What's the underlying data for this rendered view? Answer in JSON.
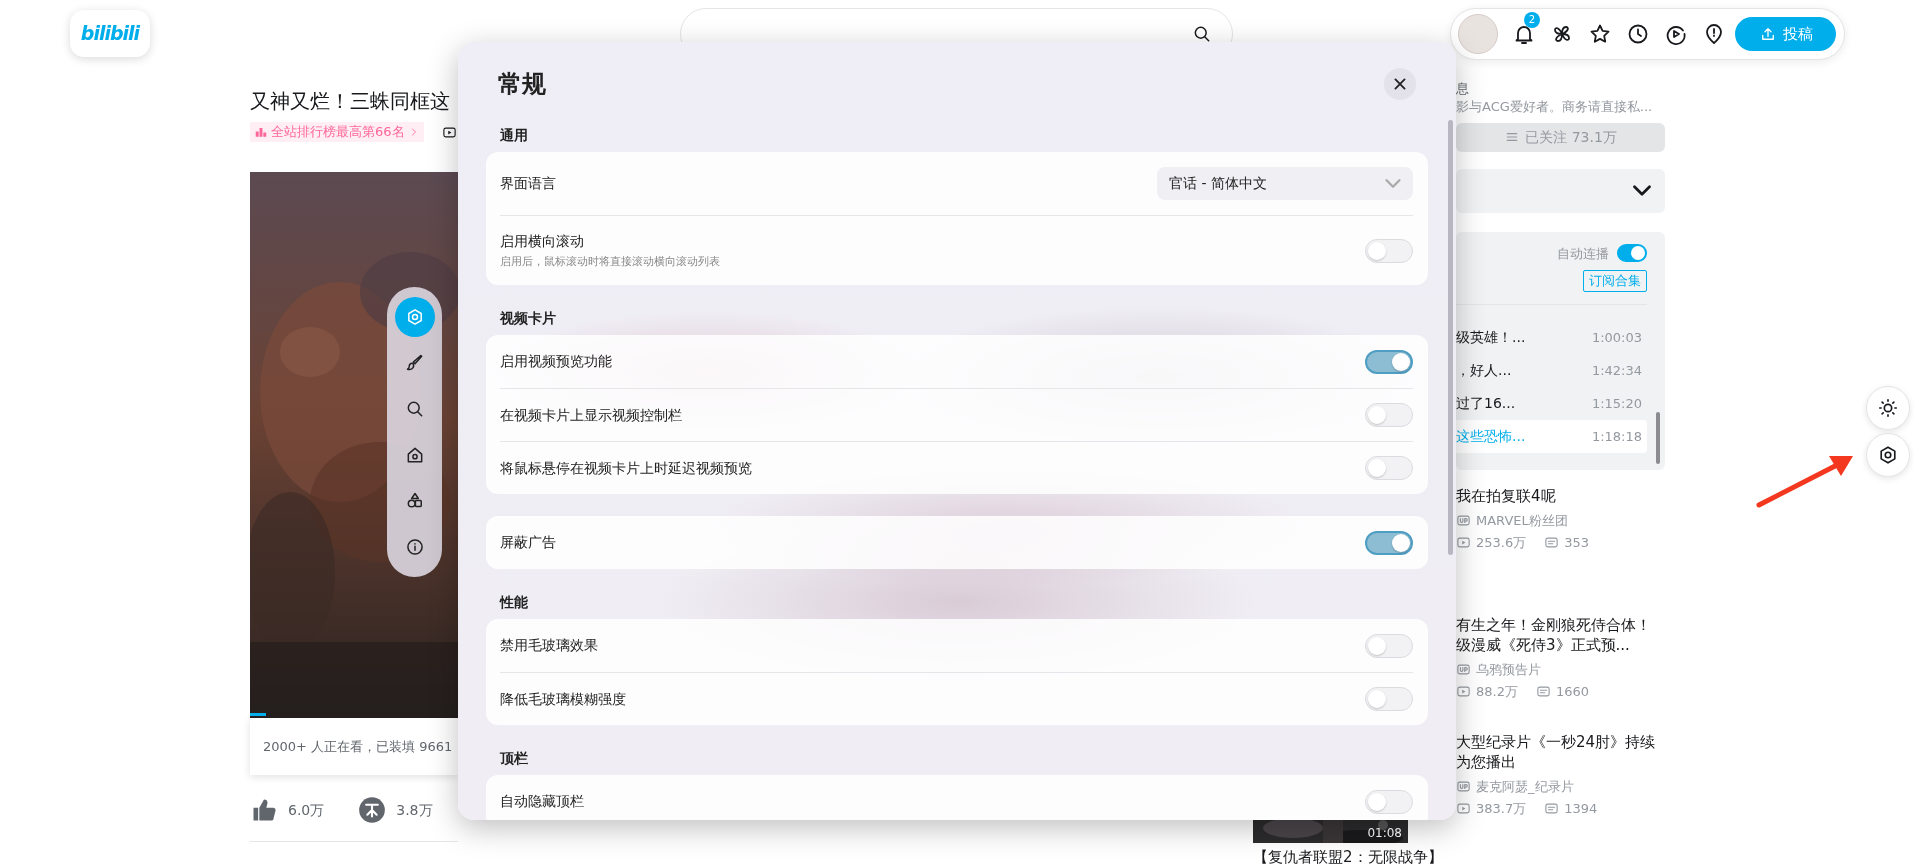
{
  "header": {
    "logo": "bilibili",
    "notification_count": "2",
    "upload_button": "投稿"
  },
  "video": {
    "title": "又神又烂！三蛛同框这",
    "rank_tag": "全站排行榜最高第66名",
    "viewer_info": "2000+ 人正在看，已装填 9661",
    "likes": "6.0万",
    "coins": "3.8万"
  },
  "tool_dock": {
    "items": [
      {
        "kind": "settings",
        "selected": true
      },
      {
        "kind": "brush",
        "selected": false
      },
      {
        "kind": "search",
        "selected": false
      },
      {
        "kind": "home",
        "selected": false
      },
      {
        "kind": "shapes",
        "selected": false
      },
      {
        "kind": "info",
        "selected": false
      }
    ]
  },
  "settings_dialog": {
    "title": "常规",
    "sections": [
      {
        "heading": "通用",
        "rows": [
          {
            "kind": "select",
            "label": "界面语言",
            "value": "官话 - 简体中文"
          },
          {
            "kind": "toggle",
            "label": "启用横向滚动",
            "description": "启用后，鼠标滚动时将直接滚动横向滚动列表",
            "on": false
          }
        ]
      },
      {
        "heading": "视频卡片",
        "rows": [
          {
            "kind": "toggle",
            "label": "启用视频预览功能",
            "on": true
          },
          {
            "kind": "toggle",
            "label": "在视频卡片上显示视频控制栏",
            "on": false
          },
          {
            "kind": "toggle",
            "label": "将鼠标悬停在视频卡片上时延迟视频预览",
            "on": false
          }
        ]
      },
      {
        "rows": [
          {
            "kind": "toggle",
            "label": "屏蔽广告",
            "on": true
          }
        ]
      },
      {
        "heading": "性能",
        "rows": [
          {
            "kind": "toggle",
            "label": "禁用毛玻璃效果",
            "on": false
          },
          {
            "kind": "toggle",
            "label": "降低毛玻璃模糊强度",
            "on": false
          }
        ]
      },
      {
        "heading": "顶栏",
        "rows": [
          {
            "kind": "toggle",
            "label": "自动隐藏顶栏",
            "on": false
          }
        ]
      }
    ]
  },
  "uploader": {
    "name": "息",
    "bio": "影与ACG爱好者。商务请直接私...",
    "follow_button": "已关注 73.1万"
  },
  "playlist": {
    "autoplay_label": "自动连播",
    "autoplay": true,
    "subscribe_button": "订阅合集",
    "items": [
      {
        "title": "级英雄！...",
        "duration": "1:00:03",
        "selected": false
      },
      {
        "title": "，好人...",
        "duration": "1:42:34",
        "selected": false
      },
      {
        "title": "过了16...",
        "duration": "1:15:20",
        "selected": false
      },
      {
        "title": "这些恐怖...",
        "duration": "1:18:18",
        "selected": true
      }
    ]
  },
  "recommendations": [
    {
      "title_lines": [
        "我在拍复联4呢"
      ],
      "uploader": "MARVEL粉丝团",
      "views": "253.6万",
      "comments": "353"
    },
    {
      "title_lines": [
        "有生之年！金刚狼死侍合体！",
        "级漫威《死侍3》正式预..."
      ],
      "uploader": "乌鸦预告片",
      "views": "88.2万",
      "comments": "1660"
    },
    {
      "title_lines": [
        "大型纪录片《一秒24肘》持续",
        "为您播出"
      ],
      "uploader": "麦克阿瑟_纪录片",
      "views": "383.7万",
      "comments": "1394",
      "thumbnail_duration": "01:08"
    },
    {
      "title_lines": [
        "【复仇者联盟2：无限战争】"
      ]
    }
  ]
}
